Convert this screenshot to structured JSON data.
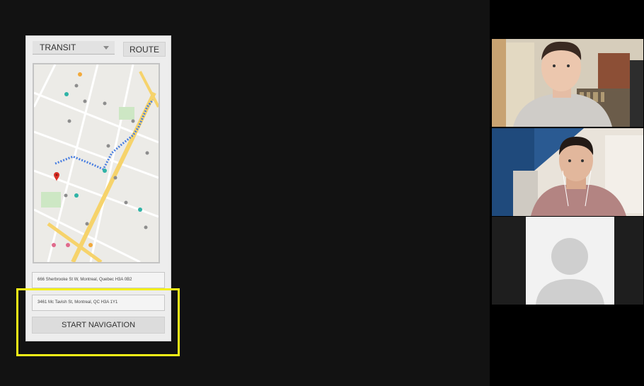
{
  "app": {
    "mode_select": {
      "value": "TRANSIT"
    },
    "route_button": {
      "label": "ROUTE"
    },
    "origin_field": {
      "value": "666 Sherbrooke St W, Montreal, Quebec H3A 0B2"
    },
    "destination_field": {
      "value": "3461 Mc Tavish St, Montreal, QC H3A 1Y1"
    },
    "start_button": {
      "label": "START NAVIGATION"
    }
  },
  "participants": [
    {
      "id": "participant-1",
      "kind": "video"
    },
    {
      "id": "participant-2",
      "kind": "video"
    },
    {
      "id": "participant-3",
      "kind": "avatar"
    }
  ],
  "colors": {
    "highlight": "#f4f017",
    "route": "#4a7fe0",
    "road": "#f6d36b",
    "pin": "#d93025"
  }
}
